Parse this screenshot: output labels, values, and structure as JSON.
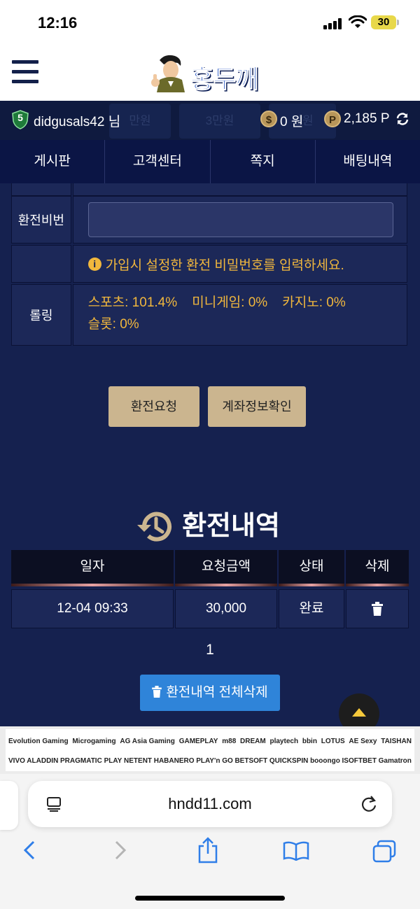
{
  "status": {
    "time": "12:16",
    "battery": "30"
  },
  "header": {
    "logo_text": "홍두깨"
  },
  "account": {
    "level": "5",
    "username": "didgusals42 님",
    "money": "0 원",
    "points": "2,185 P",
    "ghost_buttons": [
      "만원",
      "3만원",
      "만원"
    ]
  },
  "tabs": [
    "게시판",
    "고객센터",
    "쪽지",
    "배팅내역"
  ],
  "form": {
    "password_label": "환전비번",
    "password_hint": "가입시 설정한 환전 비밀번호를 입력하세요.",
    "rolling_label": "롤링",
    "rolling_line1": "스포츠: 101.4%    미니게임: 0%    카지노: 0%",
    "rolling_line2": "슬롯: 0%"
  },
  "buttons": {
    "request": "환전요청",
    "account_info": "계좌정보확인"
  },
  "history": {
    "title": "환전내역",
    "columns": [
      "일자",
      "요청금액",
      "상태",
      "삭제"
    ],
    "rows": [
      {
        "date": "12-04 09:33",
        "amount": "30,000",
        "status": "완료"
      }
    ],
    "page": "1",
    "delete_all": "환전내역 전체삭제"
  },
  "providers": {
    "row1": [
      "Evolution Gaming",
      "Microgaming",
      "AG Asia Gaming",
      "GAMEPLAY",
      "m88",
      "DREAM",
      "playtech",
      "bbin",
      "LOTUS",
      "AE Sexy",
      "TAISHAN"
    ],
    "row2": [
      "VIVO ALADDIN",
      "PRAGMATIC PLAY",
      "NETENT",
      "HABANERO",
      "PLAY'n GO",
      "BETSOFT",
      "QUICKSPIN",
      "booongo",
      "ISOFTBET",
      "Gamatron"
    ]
  },
  "browser": {
    "url": "hndd11.com"
  }
}
